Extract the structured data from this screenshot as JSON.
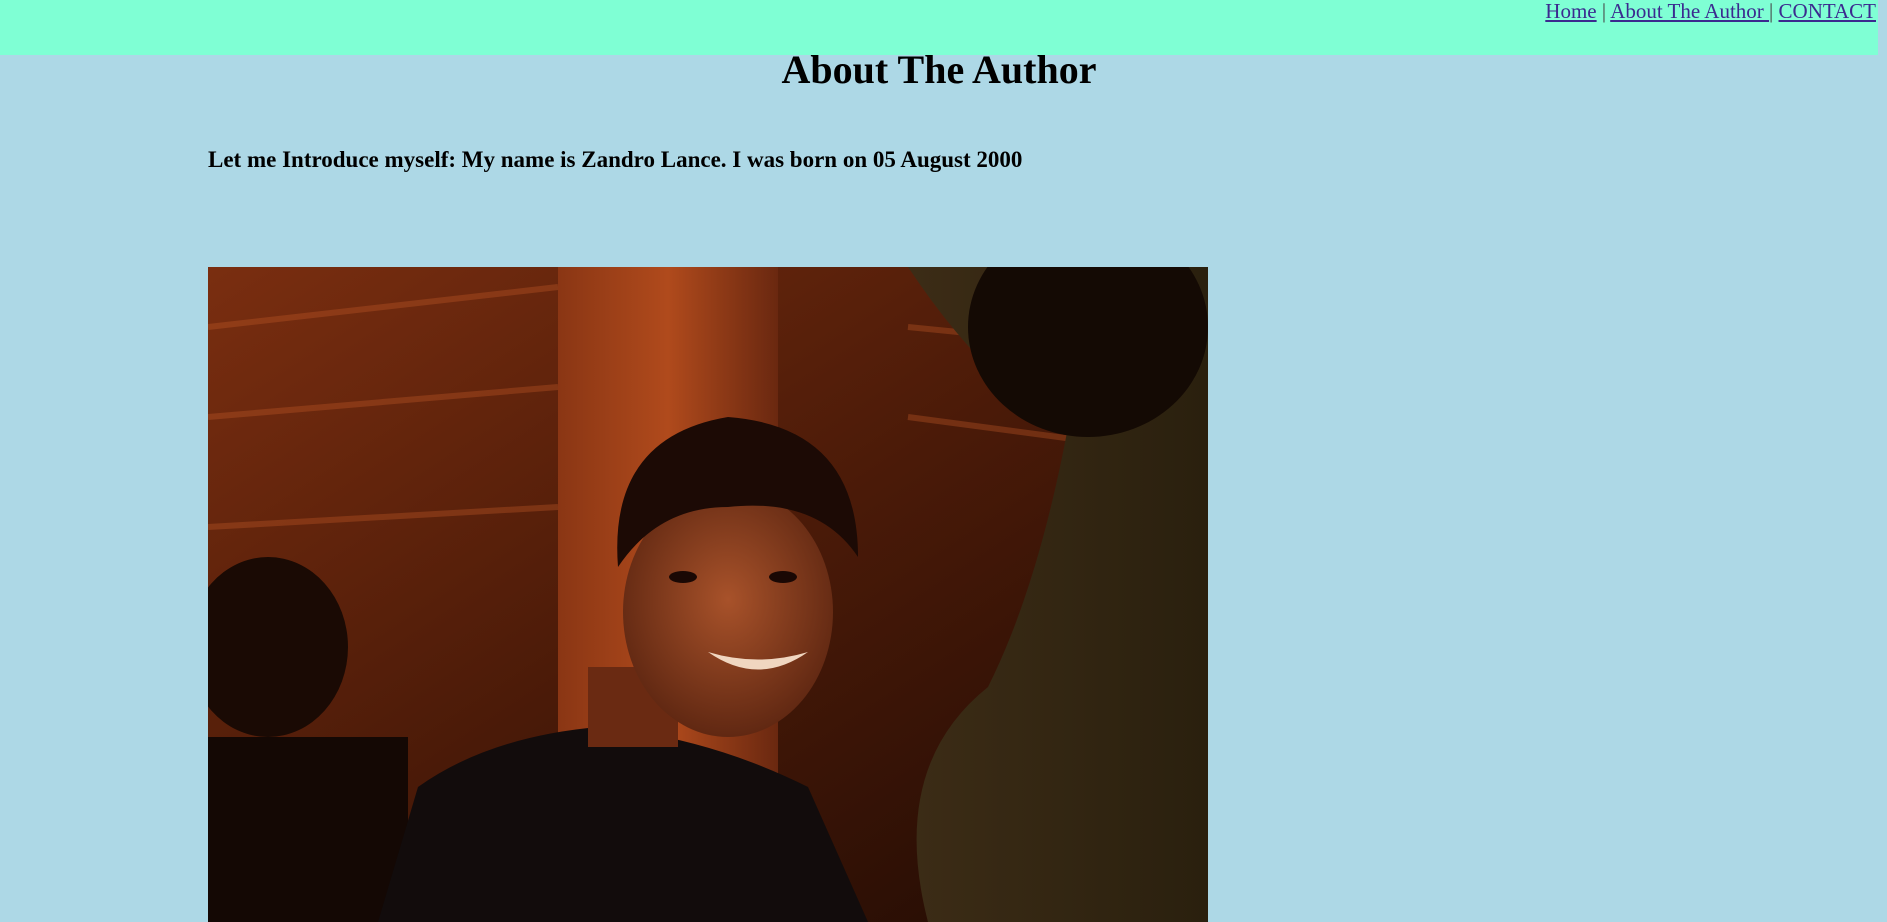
{
  "nav": {
    "home": "Home",
    "about": "About The Author ",
    "contact": "CONTACT",
    "separator": "|"
  },
  "page": {
    "title": "About The Author",
    "intro": "Let me Introduce myself: My name is Zandro Lance. I was born on 05 August 2000"
  },
  "colors": {
    "header_bg": "#7fffd4",
    "page_bg": "#add8e6",
    "link": "#3b2a8f"
  },
  "photo": {
    "icon": "author-photo"
  }
}
